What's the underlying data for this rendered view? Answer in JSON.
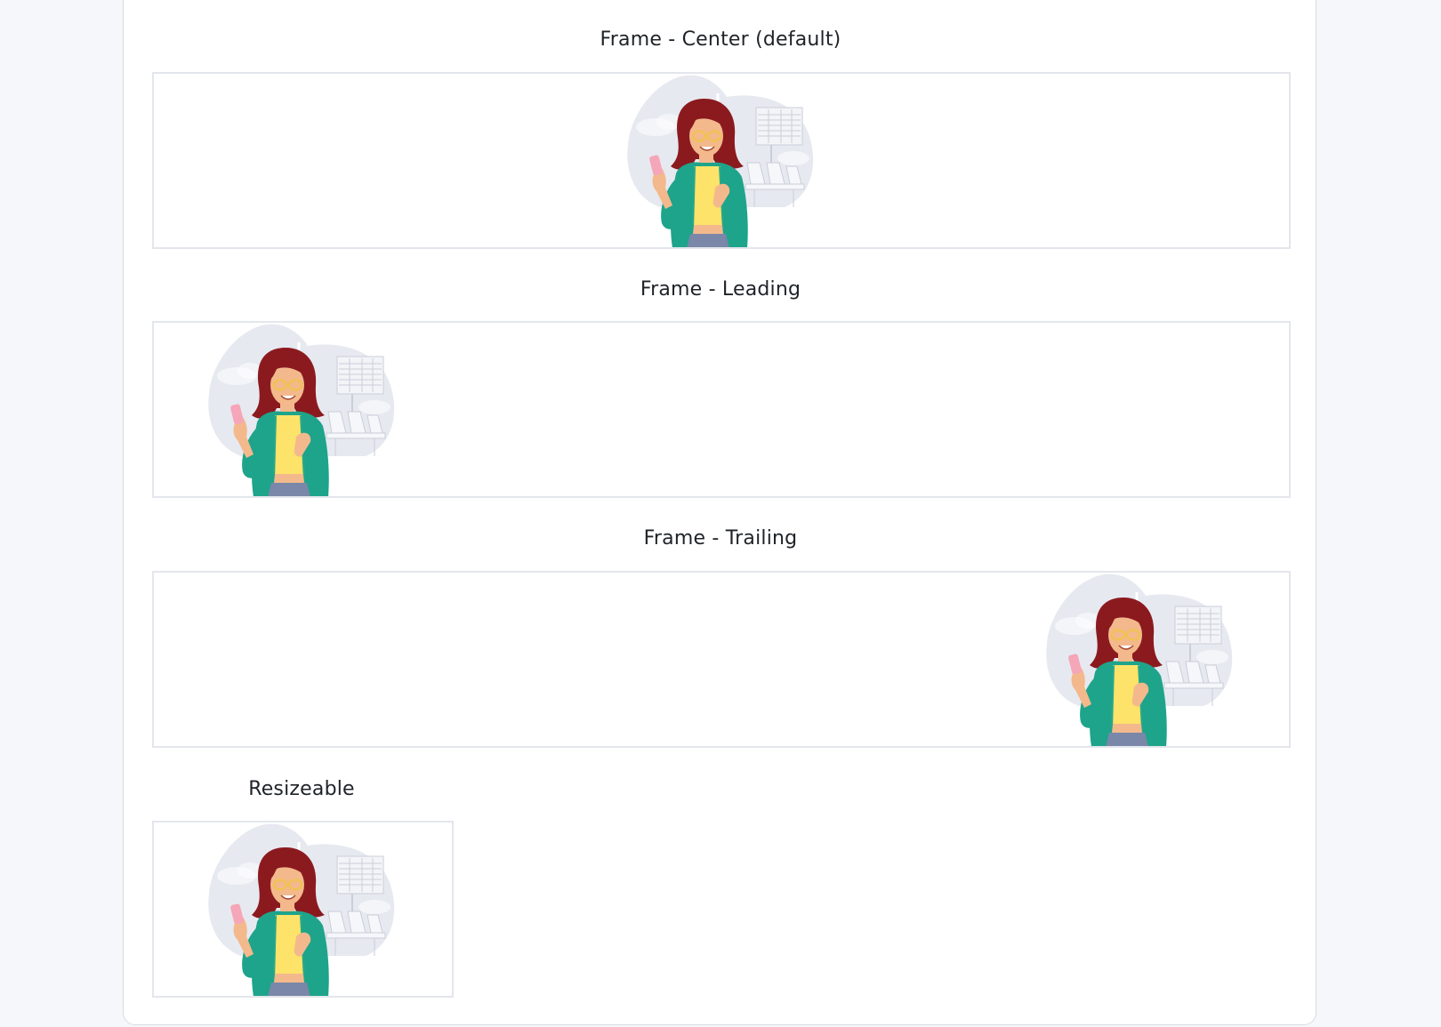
{
  "sections": [
    {
      "title": "Frame - Center (default)",
      "alignment": "center"
    },
    {
      "title": "Frame - Leading",
      "alignment": "leading"
    },
    {
      "title": "Frame - Trailing",
      "alignment": "trailing"
    },
    {
      "title": "Resizeable",
      "alignment": "leading"
    }
  ],
  "illustration": {
    "subject": "woman-with-phone-illustration",
    "colors": {
      "blob": "#e4e7ee",
      "hair": "#8b1a1f",
      "skin": "#f3b98c",
      "shirt": "#fde36a",
      "cardigan": "#1ea48a",
      "pants": "#7a87a8",
      "phone": "#f5a6b8",
      "glasses": "#f2c24f"
    }
  }
}
